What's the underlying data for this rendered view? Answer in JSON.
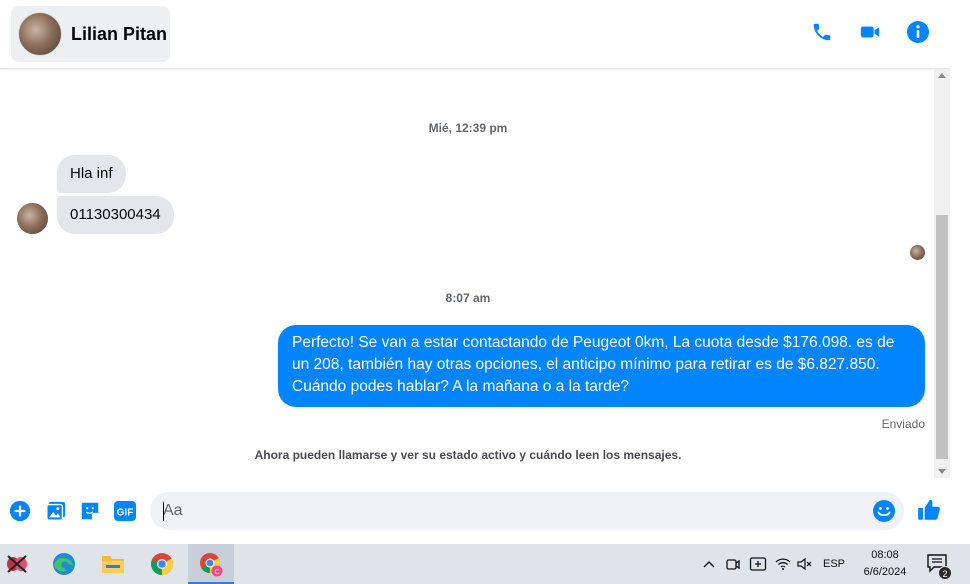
{
  "header": {
    "contact_name": "Lilian Pitan",
    "icons": [
      "phone-icon",
      "video-camera-icon",
      "info-icon"
    ],
    "accent_color": "#0084ff"
  },
  "conversation": {
    "timestamp_1": "Mié, 12:39 pm",
    "incoming_messages": [
      "Hla inf",
      "01130300434"
    ],
    "timestamp_2": "8:07 am",
    "outgoing_message": "Perfecto!  Se van a estar contactando de Peugeot 0km, La cuota desde $176.098. es de un 208, también hay otras opciones, el anticipo mínimo para retirar es de $6.827.850. Cuándo podes hablar? A la mañana o a la tarde?",
    "sent_status": "Enviado",
    "system_note": "Ahora pueden llamarse y ver su estado activo y cuándo leen los mensajes."
  },
  "composer": {
    "placeholder": "Aa",
    "value": "",
    "gif_label": "GIF"
  },
  "taskbar": {
    "language": "ESP",
    "time": "08:08",
    "date": "6/6/2024",
    "notification_count": "2"
  }
}
